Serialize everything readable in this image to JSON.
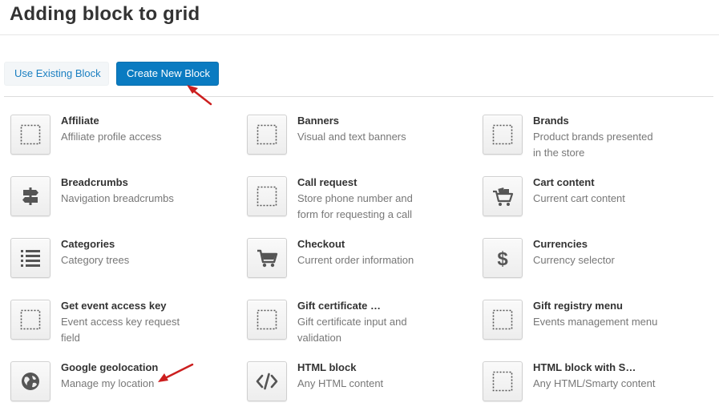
{
  "page_title": "Adding block to grid",
  "buttons": {
    "use_existing": "Use Existing Block",
    "create_new": "Create New Block"
  },
  "colors": {
    "primary": "#0a7bc1",
    "link": "#1a7fc1",
    "annotation_arrow": "#cc1f1f"
  },
  "blocks": [
    {
      "name": "Affiliate",
      "description": "Affiliate profile access",
      "icon": "placeholder-icon"
    },
    {
      "name": "Banners",
      "description": "Visual and text banners",
      "icon": "placeholder-icon"
    },
    {
      "name": "Brands",
      "description": "Product brands presented in the store",
      "icon": "placeholder-icon"
    },
    {
      "name": "Breadcrumbs",
      "description": "Navigation breadcrumbs",
      "icon": "signpost-icon"
    },
    {
      "name": "Call request",
      "description": "Store phone number and form for requesting a call",
      "icon": "placeholder-icon"
    },
    {
      "name": "Cart content",
      "description": "Current cart content",
      "icon": "cart-content-icon"
    },
    {
      "name": "Categories",
      "description": "Category trees",
      "icon": "list-icon"
    },
    {
      "name": "Checkout",
      "description": "Current order information",
      "icon": "cart-icon"
    },
    {
      "name": "Currencies",
      "description": "Currency selector",
      "icon": "dollar-icon"
    },
    {
      "name": "Get event access key",
      "description": "Event access key request field",
      "icon": "placeholder-icon"
    },
    {
      "name": "Gift certificate …",
      "description": "Gift certificate input and validation",
      "icon": "placeholder-icon"
    },
    {
      "name": "Gift registry menu",
      "description": "Events management menu",
      "icon": "placeholder-icon"
    },
    {
      "name": "Google geolocation",
      "description": "Manage my location",
      "icon": "globe-icon"
    },
    {
      "name": "HTML block",
      "description": "Any HTML content",
      "icon": "code-icon"
    },
    {
      "name": "HTML block with S…",
      "description": "Any HTML/Smarty content",
      "icon": "placeholder-icon"
    }
  ]
}
